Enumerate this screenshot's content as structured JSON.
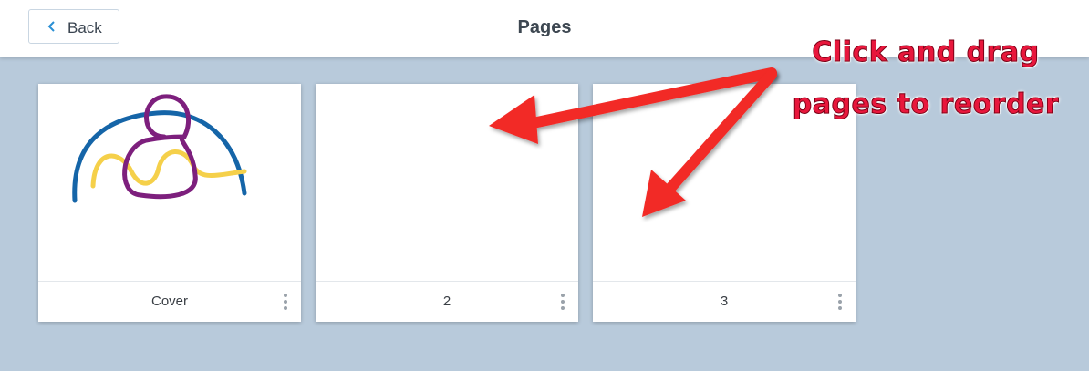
{
  "header": {
    "back_label": "Back",
    "title": "Pages"
  },
  "pages": [
    {
      "label": "Cover",
      "menu_icon": "more-vertical-icon"
    },
    {
      "label": "2",
      "menu_icon": "more-vertical-icon"
    },
    {
      "label": "3",
      "menu_icon": "more-vertical-icon"
    }
  ],
  "annotation": {
    "line1": "Click and drag",
    "line2": "pages to reorder"
  },
  "colors": {
    "background": "#b8cadb",
    "annotation": "#e8173c",
    "doodle_blue": "#1565a8",
    "doodle_yellow": "#f5d04a",
    "doodle_purple": "#7d1f7d"
  }
}
